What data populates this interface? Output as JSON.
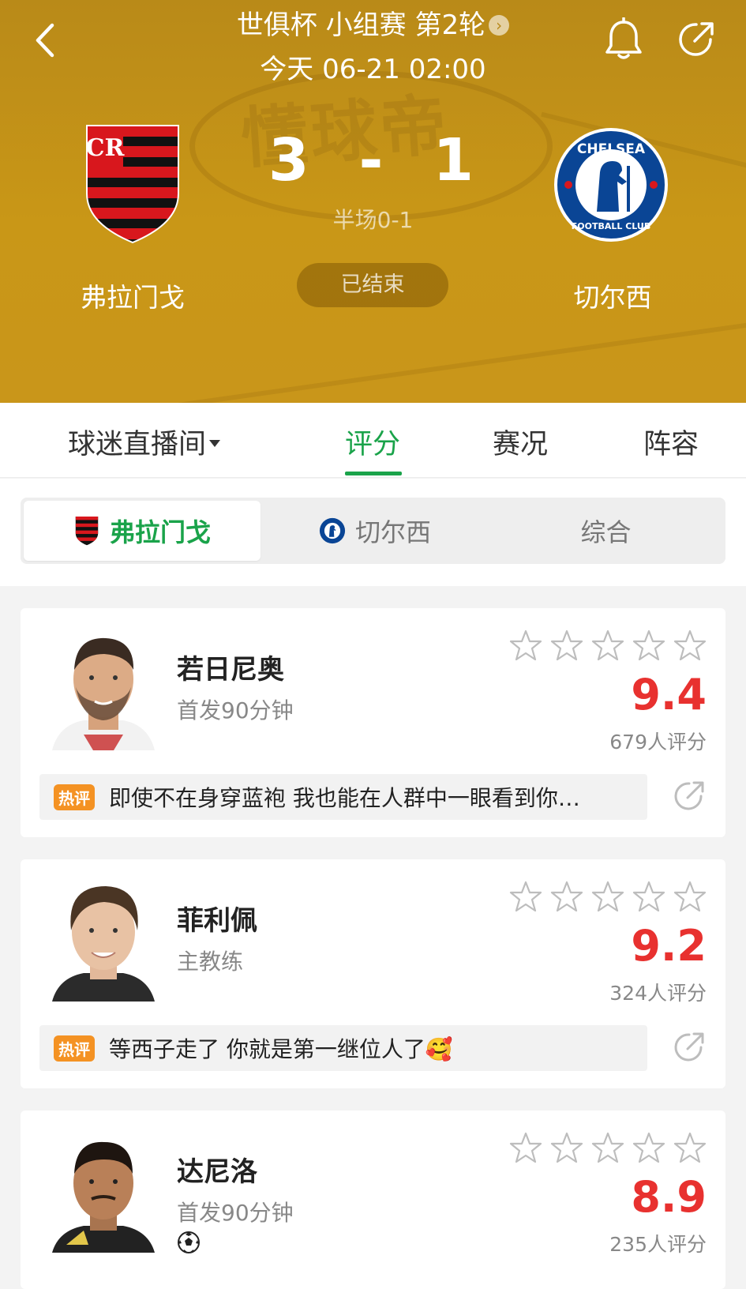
{
  "header": {
    "title": "世俱杯 小组赛 第2轮",
    "time": "今天 06-21 02:00",
    "watermark": "懂球帝",
    "home": {
      "name": "弗拉门戈",
      "score": "3"
    },
    "away": {
      "name": "切尔西",
      "score": "1"
    },
    "score_sep": "-",
    "halftime": "半场0-1",
    "status": "已结束"
  },
  "tabs": [
    {
      "label": "球迷直播间"
    },
    {
      "label": "评分"
    },
    {
      "label": "赛况"
    },
    {
      "label": "阵容"
    }
  ],
  "segment": {
    "home": "弗拉门戈",
    "away": "切尔西",
    "overall": "综合"
  },
  "players": [
    {
      "name": "若日尼奥",
      "role": "首发90分钟",
      "rating": "9.4",
      "votes": "679人评分",
      "hot_tag": "热评",
      "hot_comment": "即使不在身穿蓝袍 我也能在人群中一眼看到你…"
    },
    {
      "name": "菲利佩",
      "role": "主教练",
      "rating": "9.2",
      "votes": "324人评分",
      "hot_tag": "热评",
      "hot_comment": "等西子走了 你就是第一继位人了🥰"
    },
    {
      "name": "达尼洛",
      "role": "首发90分钟",
      "rating": "8.9",
      "votes": "235人评分"
    }
  ],
  "colors": {
    "accent": "#1aa34a",
    "rating": "#e8312f",
    "hero": "#c99717",
    "hot_tag": "#f49223"
  }
}
